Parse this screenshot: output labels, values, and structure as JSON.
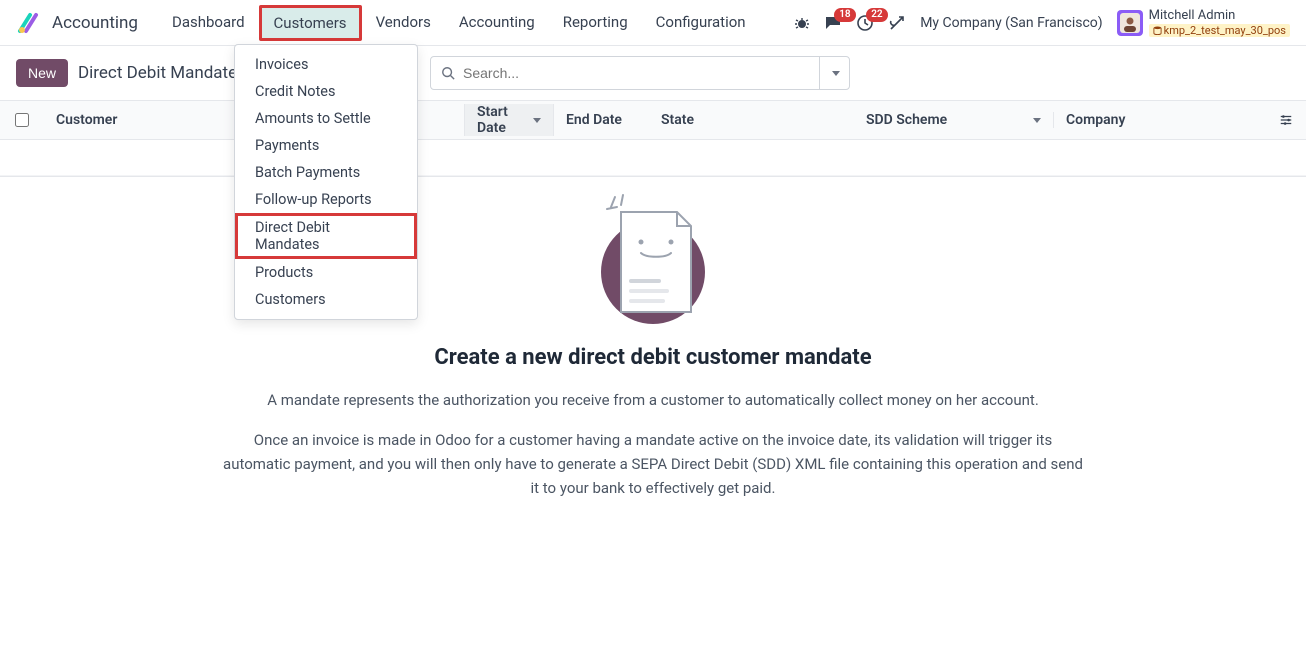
{
  "app_name": "Accounting",
  "nav": {
    "items": [
      "Dashboard",
      "Customers",
      "Vendors",
      "Accounting",
      "Reporting",
      "Configuration"
    ],
    "active_index": 1
  },
  "dropdown": {
    "items": [
      "Invoices",
      "Credit Notes",
      "Amounts to Settle",
      "Payments",
      "Batch Payments",
      "Follow-up Reports",
      "Direct Debit Mandates",
      "Products",
      "Customers"
    ],
    "highlighted_index": 6
  },
  "topbar_right": {
    "messages_badge": "18",
    "activities_badge": "22",
    "company": "My Company (San Francisco)",
    "user_name": "Mitchell Admin",
    "user_db": "kmp_2_test_may_30_pos"
  },
  "subbar": {
    "new_label": "New",
    "breadcrumb": "Direct Debit Mandate"
  },
  "search": {
    "placeholder": "Search..."
  },
  "table": {
    "columns": {
      "customer": "Customer",
      "start_date": "Start Date",
      "end_date": "End Date",
      "state": "State",
      "sdd_scheme": "SDD Scheme",
      "company": "Company"
    }
  },
  "empty": {
    "title": "Create a new direct debit customer mandate",
    "p1": "A mandate represents the authorization you receive from a customer to automatically collect money on her account.",
    "p2": "Once an invoice is made in Odoo for a customer having a mandate active on the invoice date, its validation will trigger its automatic payment, and you will then only have to generate a SEPA Direct Debit (SDD) XML file containing this operation and send it to your bank to effectively get paid."
  }
}
